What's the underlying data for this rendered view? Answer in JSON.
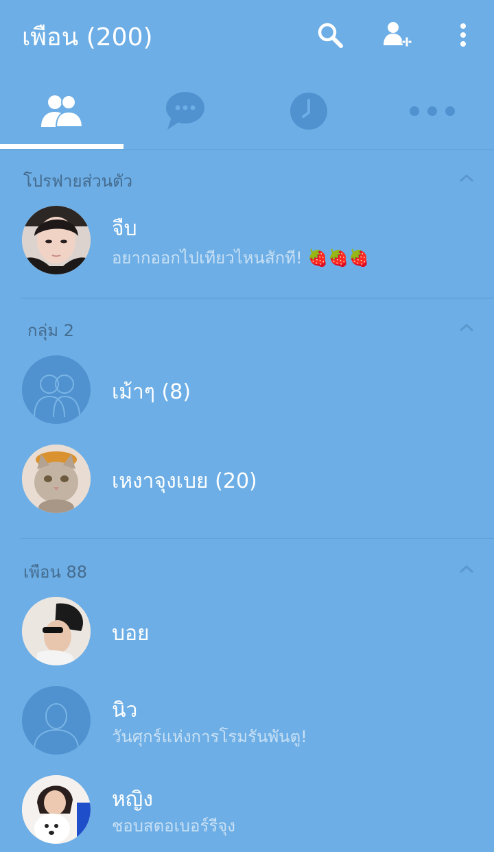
{
  "header": {
    "title": "เพือน (200)",
    "icons": [
      "search-icon",
      "add-friend-icon",
      "more-vert-icon"
    ]
  },
  "tabs": [
    {
      "icon": "friends-icon",
      "active": true
    },
    {
      "icon": "chat-icon",
      "active": false
    },
    {
      "icon": "timeline-clock-icon",
      "active": false
    },
    {
      "icon": "more-horiz-icon",
      "active": false
    }
  ],
  "sections": {
    "profile": {
      "title": "โปรฟายส่วนตัว",
      "items": [
        {
          "name": "จืบ",
          "status": "อยากออกไปเทียวไหนสักที! 🍓🍓🍓"
        }
      ]
    },
    "groups": {
      "title": "กลุ่ม 2",
      "items": [
        {
          "name": "เม้าๆ (8)"
        },
        {
          "name": "เหงาจุงเบย (20)"
        }
      ]
    },
    "friends": {
      "title": "เพือน 88",
      "items": [
        {
          "name": "บอย"
        },
        {
          "name": "นิว",
          "status": "วันศุกร์แห่งการโรมรันพันตู!"
        },
        {
          "name": "หญิง",
          "status": "ชอบสตอเบอร์รีจุง"
        }
      ]
    }
  },
  "colors": {
    "background": "#6caee5",
    "section_title": "#456b8e",
    "placeholder_avatar": "#4f92cf",
    "status_text": "#c8e0f5"
  }
}
